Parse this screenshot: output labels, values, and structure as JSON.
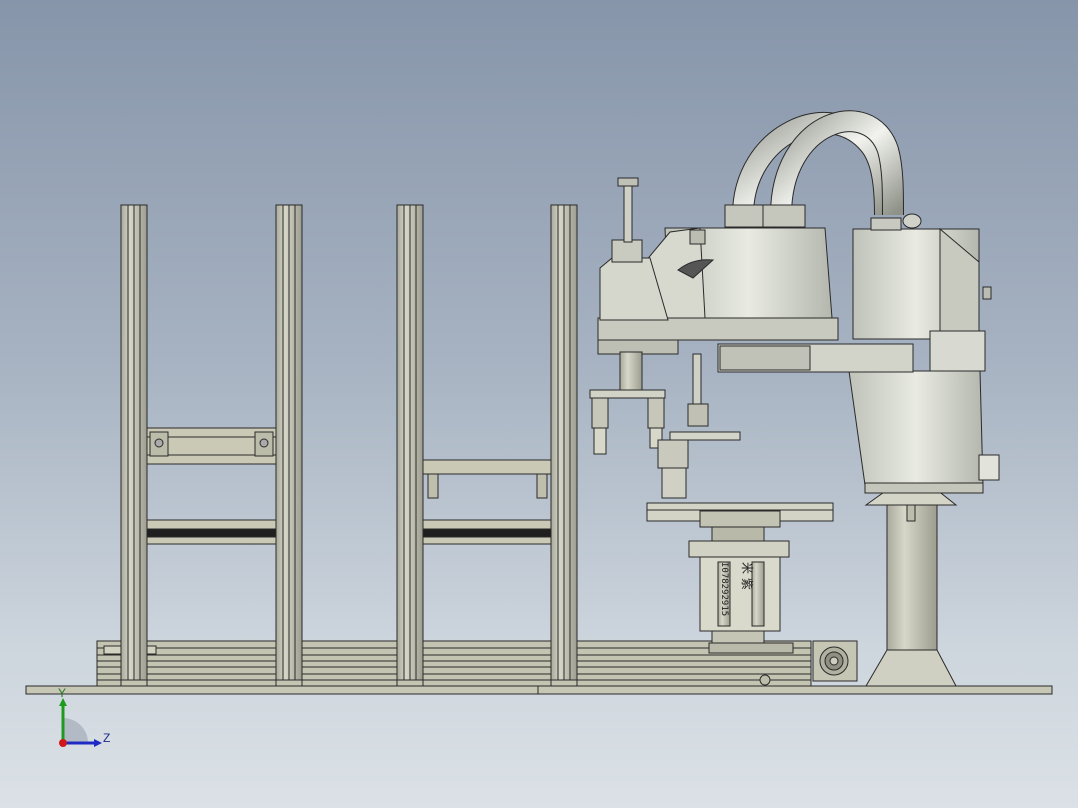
{
  "viewport": {
    "background_top": "#8795aa",
    "background_bottom": "#dbe1e6",
    "model_face_color": "#c9c9b6",
    "model_edge_color": "#2a2a2a",
    "robot_body_color": "#d4d6cc"
  },
  "part_marking": {
    "serial": "I078292915",
    "chars": "米 紫"
  },
  "triad": {
    "y_label": "Y",
    "z_label": "Z",
    "y_color": "#1e9a1e",
    "z_color": "#1f2ac4",
    "x_color": "#d01818"
  }
}
